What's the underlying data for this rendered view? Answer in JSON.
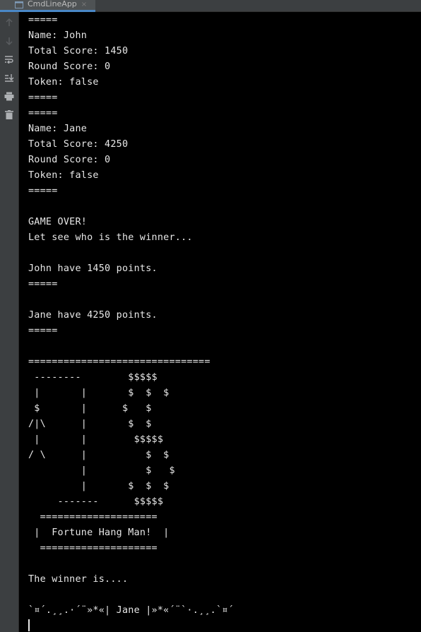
{
  "tab": {
    "title": "CmdLineApp",
    "close_glyph": "×"
  },
  "gutter": {
    "icons": [
      "up-arrow-icon",
      "down-arrow-icon",
      "soft-wrap-icon",
      "scroll-to-end-icon",
      "print-icon",
      "trash-icon"
    ]
  },
  "console": {
    "lines": [
      "=====",
      "Name: John",
      "Total Score: 1450",
      "Round Score: 0",
      "Token: false",
      "=====",
      "=====",
      "Name: Jane",
      "Total Score: 4250",
      "Round Score: 0",
      "Token: false",
      "=====",
      "",
      "GAME OVER!",
      "Let see who is the winner...",
      "",
      "John have 1450 points.",
      "=====",
      "",
      "Jane have 4250 points.",
      "=====",
      "",
      "===============================",
      " --------        $$$$$",
      " |       |       $  $  $",
      " $       |      $   $",
      "/|\\      |       $  $",
      " |       |        $$$$$",
      "/ \\      |          $  $",
      "         |          $   $",
      "         |       $  $  $",
      "     -------      $$$$$",
      "  ====================",
      " |  Fortune Hang Man!  |",
      "  ====================",
      "",
      "The winner is....",
      "",
      "`¤´.¸¸.·´¨»*«| Jane |»*«´¨`·.¸¸.`¤´"
    ]
  },
  "colors": {
    "background": "#000000",
    "text": "#e8e8e8",
    "chrome": "#3c3f41",
    "tab_accent": "#4a88c7"
  }
}
